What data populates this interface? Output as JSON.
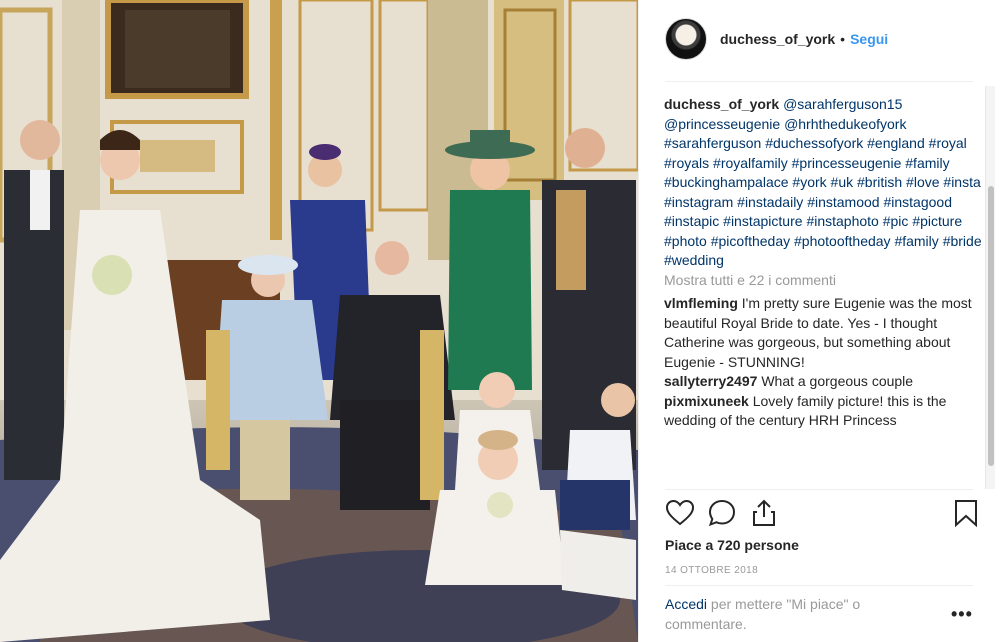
{
  "post": {
    "username": "duchess_of_york",
    "follow_label": "Segui",
    "separator": "•"
  },
  "caption": {
    "username": "duchess_of_york",
    "segments": [
      "@sarahferguson15",
      "@princesseugenie",
      "@hrhthedukeofyork",
      "#sarahferguson",
      "#duchessofyork",
      "#england",
      "#royal",
      "#royals",
      "#royalfamily",
      "#princesseugenie",
      "#family",
      "#buckinghampalace",
      "#york",
      "#uk",
      "#british",
      "#love",
      "#insta",
      "#instagram",
      "#instadaily",
      "#instamood",
      "#instagood",
      "#instapic",
      "#instapicture",
      "#instaphoto",
      "#pic",
      "#picture",
      "#photo",
      "#picoftheday",
      "#photooftheday",
      "#family",
      "#bride",
      "#wedding"
    ]
  },
  "show_comments_label": "Mostra tutti e 22 i commenti",
  "comments": [
    {
      "user": "vlmfleming",
      "text": "I'm pretty sure Eugenie was the most beautiful Royal Bride to date. Yes - I thought Catherine was gorgeous, but something about Eugenie - STUNNING!"
    },
    {
      "user": "sallyterry2497",
      "text": "What a gorgeous couple"
    },
    {
      "user": "pixmixuneek",
      "text": "Lovely family picture! this is the wedding of the century HRH Princess"
    }
  ],
  "actions": {
    "like_icon": "heart-icon",
    "comment_icon": "comment-bubble-icon",
    "share_icon": "share-icon",
    "save_icon": "bookmark-icon"
  },
  "likes_text": "Piace a 720 persone",
  "date_text": "14 OTTOBRE 2018",
  "login": {
    "link": "Accedi",
    "text": "per mettere \"Mi piace\" o commentare."
  },
  "more_options": "•••",
  "colors": {
    "link": "#003569",
    "follow": "#3897f0",
    "muted": "#999999",
    "text": "#262626"
  }
}
